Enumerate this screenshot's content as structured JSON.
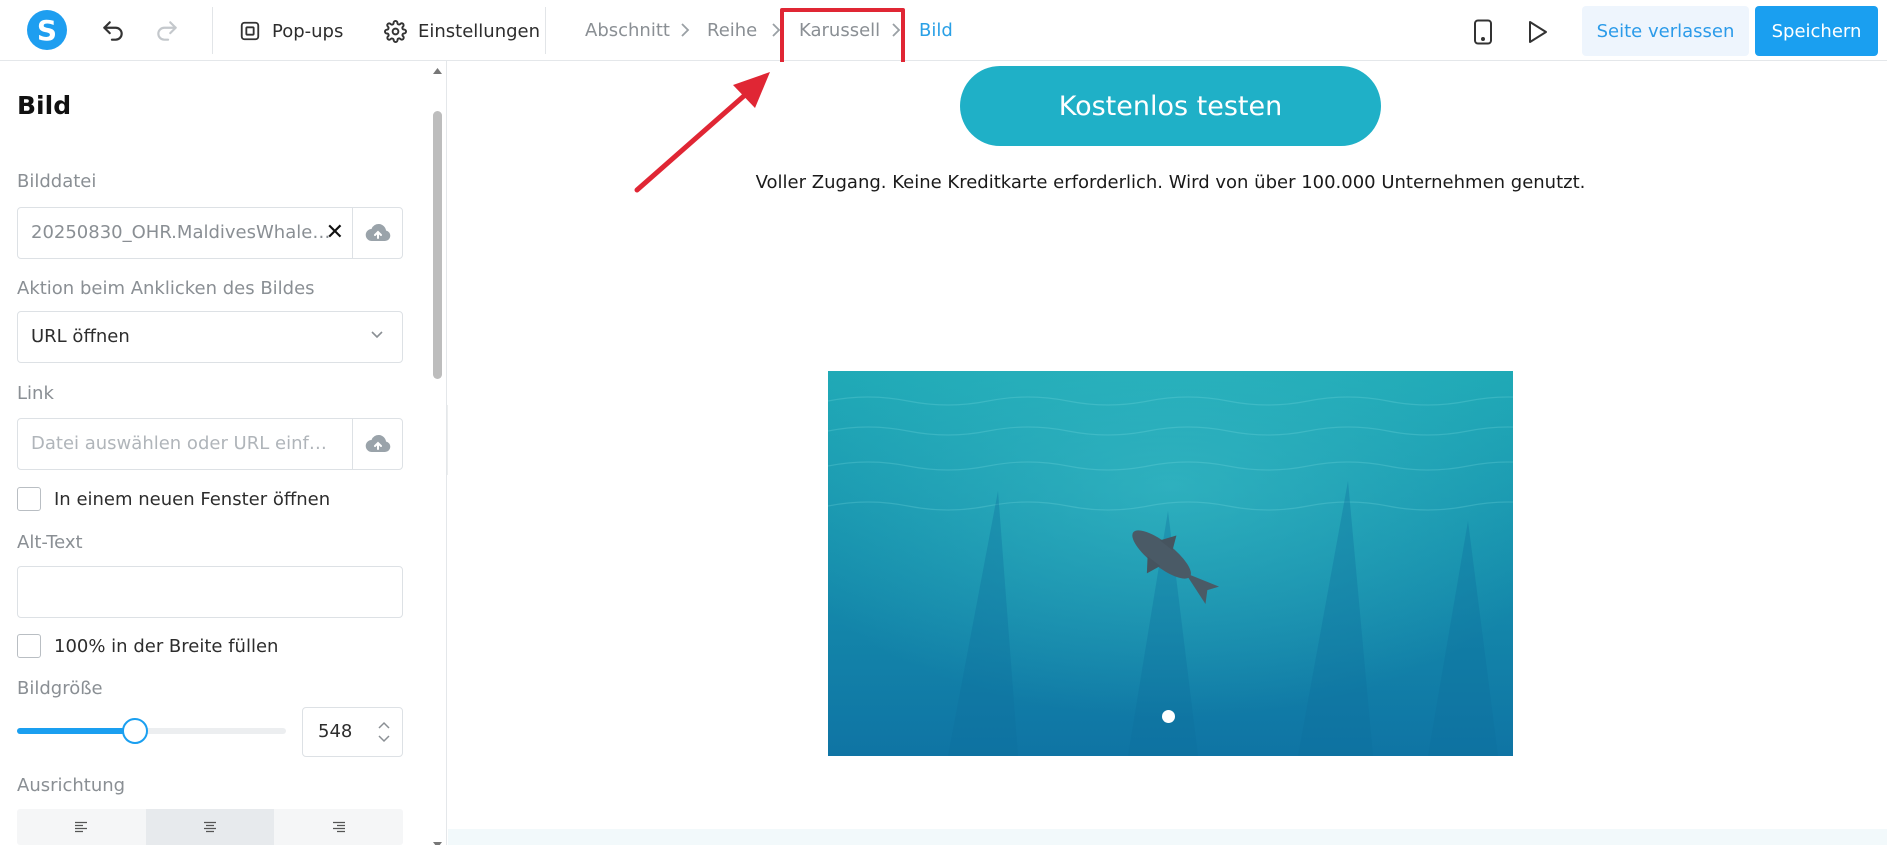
{
  "topbar": {
    "logo_letter": "S",
    "popups_label": "Pop-ups",
    "settings_label": "Einstellungen",
    "breadcrumbs": [
      "Abschnitt",
      "Reihe",
      "Karussell",
      "Bild"
    ],
    "leave_label": "Seite verlassen",
    "save_label": "Speichern"
  },
  "sidebar": {
    "title": "Bild",
    "image_file_label": "Bilddatei",
    "image_file_value": "20250830_OHR.MaldivesWhaleS...",
    "click_action_label": "Aktion beim Anklicken des Bildes",
    "click_action_value": "URL öffnen",
    "link_label": "Link",
    "link_placeholder": "Datei auswählen oder URL einfü...",
    "new_window_label": "In einem neuen Fenster öffnen",
    "alt_text_label": "Alt-Text",
    "alt_text_value": "",
    "full_width_label": "100% in der Breite füllen",
    "image_size_label": "Bildgröße",
    "image_size_value": "548",
    "image_size_fraction": 0.44,
    "alignment_label": "Ausrichtung",
    "alignment_selected": "center"
  },
  "canvas": {
    "cta_label": "Kostenlos testen",
    "subtext": "Voller Zugang. Keine Kreditkarte erforderlich. Wird von über 100.000 Unternehmen genutzt."
  },
  "colors": {
    "accent": "#1a9ff0",
    "cta": "#1fb0c7",
    "highlight": "#e02634"
  }
}
